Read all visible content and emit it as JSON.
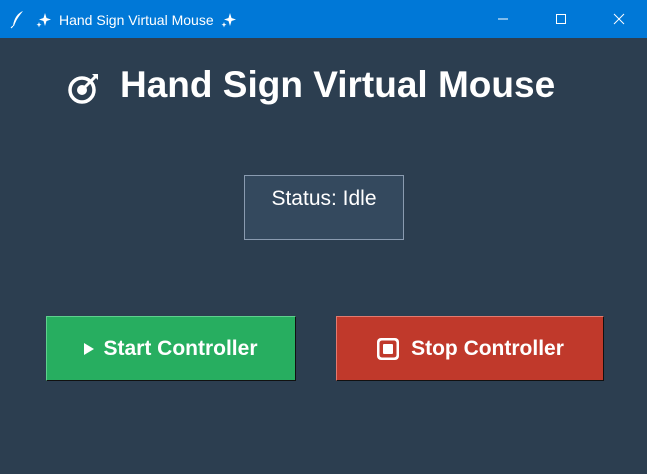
{
  "window": {
    "title": "Hand Sign Virtual Mouse",
    "app_icon": "feather-icon",
    "title_decoration_icon": "sparkles-icon",
    "controls": [
      "minimize-icon",
      "maximize-icon",
      "close-icon"
    ]
  },
  "header": {
    "icon": "target-dart-icon",
    "title": "Hand Sign Virtual Mouse"
  },
  "status": {
    "label": "Status: Idle"
  },
  "buttons": {
    "start": {
      "label": "Start Controller",
      "icon": "play-icon",
      "color": "#27ae60"
    },
    "stop": {
      "label": "Stop Controller",
      "icon": "stop-button-icon",
      "color": "#c0392b"
    }
  },
  "colors": {
    "titlebar": "#0078d7",
    "background": "#2c3e50",
    "status_box": "#34495e"
  }
}
